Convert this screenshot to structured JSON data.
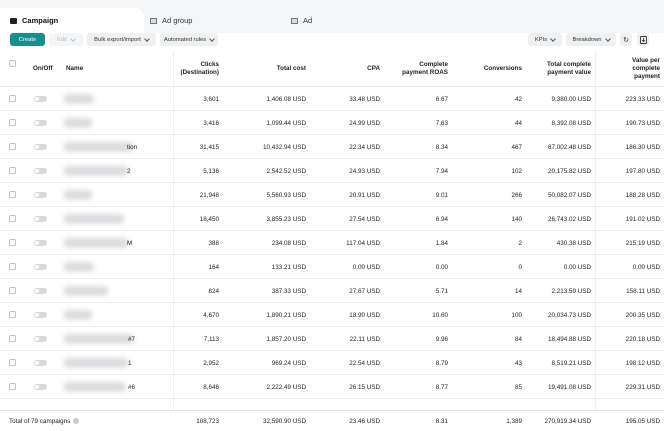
{
  "tabs": [
    {
      "label": "Campaign",
      "icon": "folder-icon"
    },
    {
      "label": "Ad group",
      "icon": "grid-icon"
    },
    {
      "label": "Ad",
      "icon": "grid-icon"
    }
  ],
  "toolbar": {
    "create": "Create",
    "edit": "Edit",
    "bulk": "Bulk export/import",
    "rules": "Automated rules",
    "kpis": "KPIs",
    "breakdown": "Breakdown"
  },
  "columns": {
    "onoff": "On/Off",
    "name": "Name",
    "clicks_1": "Clicks",
    "clicks_2": "(Destination)",
    "cost": "Total cost",
    "cpa": "CPA",
    "roas_1": "Complete",
    "roas_2": "payment ROAS",
    "conversions": "Conversions",
    "value_1": "Total complete",
    "value_2": "payment value",
    "vpc_1": "Value per",
    "vpc_2": "complete",
    "vpc_3": "payment"
  },
  "rows": [
    {
      "name_tail": "",
      "clicks": "3,601",
      "cost": "1,406.08 USD",
      "cpa": "33.48 USD",
      "roas": "6.67",
      "conv": "42",
      "value": "9,380.00 USD",
      "vpc": "223.33 USD"
    },
    {
      "name_tail": "",
      "clicks": "3,416",
      "cost": "1,099.44 USD",
      "cpa": "24.99 USD",
      "roas": "7.63",
      "conv": "44",
      "value": "8,392.08 USD",
      "vpc": "190.73 USD"
    },
    {
      "name_tail": "tion",
      "clicks": "31,415",
      "cost": "10,432.94 USD",
      "cpa": "22.34 USD",
      "roas": "8.34",
      "conv": "467",
      "value": "87,002.48 USD",
      "vpc": "186.30 USD"
    },
    {
      "name_tail": "2",
      "clicks": "5,136",
      "cost": "2,542.52 USD",
      "cpa": "24.93 USD",
      "roas": "7.94",
      "conv": "102",
      "value": "20,175.82 USD",
      "vpc": "197.80 USD"
    },
    {
      "name_tail": "",
      "clicks": "21,948",
      "cost": "5,560.93 USD",
      "cpa": "20.91 USD",
      "roas": "9.01",
      "conv": "266",
      "value": "50,082.07 USD",
      "vpc": "188.28 USD"
    },
    {
      "name_tail": "",
      "clicks": "18,450",
      "cost": "3,855.23 USD",
      "cpa": "27.54 USD",
      "roas": "6.94",
      "conv": "140",
      "value": "26,743.02 USD",
      "vpc": "191.02 USD"
    },
    {
      "name_tail": "M",
      "clicks": "388",
      "cost": "234.08 USD",
      "cpa": "117.04 USD",
      "roas": "1.84",
      "conv": "2",
      "value": "430.38 USD",
      "vpc": "215.19 USD"
    },
    {
      "name_tail": "",
      "clicks": "164",
      "cost": "133.21 USD",
      "cpa": "0.00 USD",
      "roas": "0.00",
      "conv": "0",
      "value": "0.00 USD",
      "vpc": "0.00 USD"
    },
    {
      "name_tail": "",
      "clicks": "824",
      "cost": "387.33 USD",
      "cpa": "27.67 USD",
      "roas": "5.71",
      "conv": "14",
      "value": "2,213.59 USD",
      "vpc": "158.11 USD"
    },
    {
      "name_tail": "",
      "clicks": "4,670",
      "cost": "1,890.21 USD",
      "cpa": "18.90 USD",
      "roas": "10.60",
      "conv": "100",
      "value": "20,034.73 USD",
      "vpc": "200.35 USD"
    },
    {
      "name_tail": "#7",
      "clicks": "7,113",
      "cost": "1,857.20 USD",
      "cpa": "22.11 USD",
      "roas": "9.96",
      "conv": "84",
      "value": "18,494.88 USD",
      "vpc": "220.18 USD"
    },
    {
      "name_tail": "1",
      "clicks": "2,952",
      "cost": "969.24 USD",
      "cpa": "22.54 USD",
      "roas": "8.79",
      "conv": "43",
      "value": "8,519.21 USD",
      "vpc": "198.12 USD"
    },
    {
      "name_tail": "#6",
      "clicks": "8,646",
      "cost": "2,222.49 USD",
      "cpa": "26.15 USD",
      "roas": "8.77",
      "conv": "85",
      "value": "19,491.08 USD",
      "vpc": "229.31 USD"
    }
  ],
  "total": {
    "label": "Total of 79 campaigns",
    "clicks": "108,723",
    "cost": "32,590.90 USD",
    "cpa": "23.46 USD",
    "roas": "8.31",
    "conv": "1,389",
    "value": "270,919.34 USD",
    "vpc": "195.05 USD"
  }
}
